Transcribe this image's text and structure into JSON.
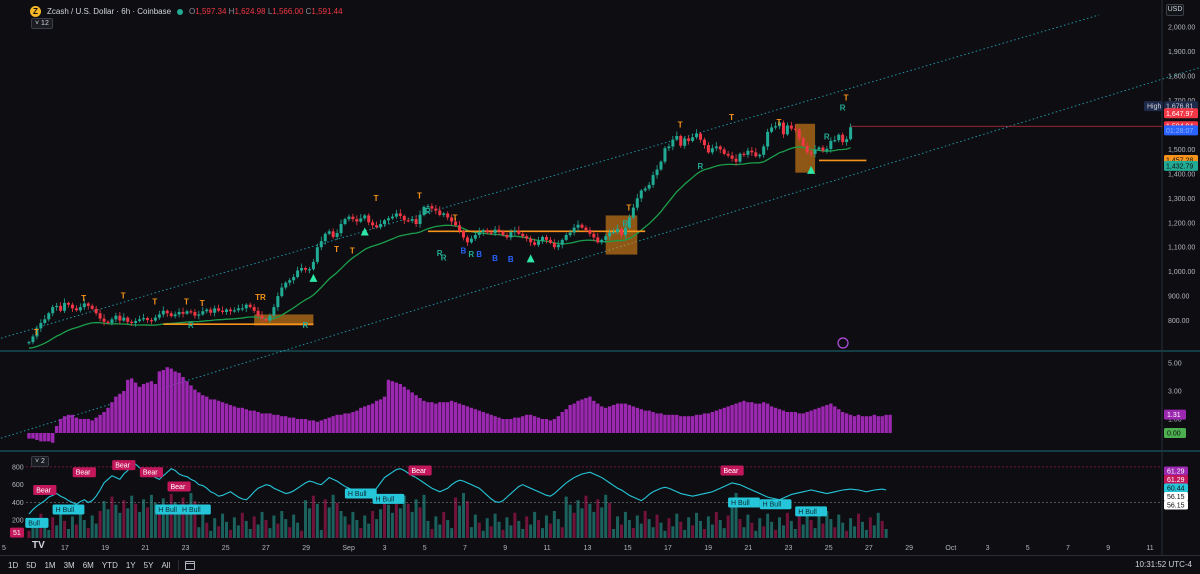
{
  "header": {
    "symbol_icon": "Z",
    "title": "Zcash / U.S. Dollar · 6h · Coinbase",
    "ohlc": [
      {
        "k": "O",
        "v": "1,597.34"
      },
      {
        "k": "H",
        "v": "1,624.98"
      },
      {
        "k": "L",
        "v": "1,566.00"
      },
      {
        "k": "C",
        "v": "1,591.44"
      }
    ],
    "indicator_badge": "12",
    "currency_button": "USD"
  },
  "osc_badge": "2",
  "rsi_badge": "51",
  "tradingview_logo": "TV",
  "bottom_toolbar": {
    "timeframes": [
      "1D",
      "5D",
      "1M",
      "3M",
      "6M",
      "YTD",
      "1Y",
      "5Y",
      "All"
    ],
    "clock": "10:31:52 UTC-4"
  },
  "colors": {
    "bull": "#22ab94",
    "bear": "#f23645",
    "volume": "#9c27b0",
    "channel": "#26c6da",
    "trend": "#1b9e4b",
    "box": "#f7931a",
    "price_line": "#f23645"
  },
  "chart_data": [
    {
      "type": "candlestick",
      "panel": "price",
      "ylim": [
        700,
        2050
      ],
      "y_ticks": [
        "800.00",
        "900.00",
        "1,000.00",
        "1,100.00",
        "1,200.00",
        "1,300.00",
        "1,400.00",
        "1,500.00",
        "1,600.00",
        "1,700.00",
        "1,800.00",
        "1,900.00",
        "2,000.00"
      ],
      "x_ticks": [
        "17",
        "19",
        "21",
        "23",
        "25",
        "27",
        "29",
        "Sep",
        "3",
        "5",
        "7",
        "9",
        "11",
        "13",
        "15",
        "17",
        "19",
        "21",
        "23",
        "25",
        "27",
        "29",
        "Oct",
        "3",
        "5",
        "7",
        "9",
        "11"
      ],
      "x_tick_pos": [
        16,
        18,
        20,
        22,
        24,
        26,
        28,
        30,
        32,
        34,
        36,
        38,
        40,
        42,
        44,
        46,
        48,
        50,
        52,
        54,
        56,
        58,
        60,
        62,
        64,
        66,
        68,
        70
      ],
      "x_start_label": "5",
      "closes": [
        712,
        735,
        768,
        790,
        805,
        830,
        855,
        860,
        840,
        872,
        865,
        850,
        842,
        855,
        870,
        860,
        848,
        830,
        808,
        795,
        790,
        805,
        820,
        800,
        812,
        795,
        790,
        798,
        805,
        810,
        802,
        800,
        812,
        825,
        840,
        830,
        818,
        825,
        835,
        828,
        838,
        835,
        820,
        825,
        838,
        845,
        832,
        850,
        840,
        835,
        845,
        838,
        842,
        850,
        850,
        865,
        855,
        840,
        820,
        808,
        800,
        820,
        855,
        900,
        935,
        955,
        965,
        978,
        1005,
        1015,
        1008,
        1010,
        1040,
        1100,
        1125,
        1155,
        1165,
        1142,
        1158,
        1195,
        1215,
        1225,
        1215,
        1205,
        1218,
        1230,
        1202,
        1190,
        1182,
        1195,
        1210,
        1218,
        1225,
        1238,
        1228,
        1210,
        1208,
        1215,
        1195,
        1232,
        1265,
        1268,
        1258,
        1250,
        1232,
        1238,
        1222,
        1205,
        1190,
        1166,
        1140,
        1120,
        1135,
        1150,
        1162,
        1170,
        1160,
        1158,
        1172,
        1165,
        1150,
        1140,
        1162,
        1168,
        1155,
        1145,
        1135,
        1120,
        1110,
        1125,
        1142,
        1130,
        1118,
        1100,
        1110,
        1130,
        1150,
        1160,
        1180,
        1192,
        1180,
        1170,
        1155,
        1140,
        1120,
        1130,
        1145,
        1160,
        1162,
        1175,
        1150,
        1180,
        1222,
        1262,
        1300,
        1332,
        1340,
        1355,
        1395,
        1418,
        1450,
        1505,
        1512,
        1540,
        1555,
        1515,
        1545,
        1535,
        1550,
        1565,
        1540,
        1518,
        1488,
        1505,
        1512,
        1500,
        1482,
        1475,
        1462,
        1450,
        1482,
        1478,
        1495,
        1488,
        1472,
        1478,
        1512,
        1572,
        1590,
        1595,
        1610,
        1562,
        1598,
        1585,
        1582,
        1545,
        1515,
        1488,
        1482,
        1500,
        1508,
        1495,
        1502,
        1535,
        1538,
        1560,
        1530,
        1542,
        1591
      ],
      "series": [
        {
          "name": "Zcash / U.S. Dollar",
          "values_key": "closes"
        }
      ],
      "price_labels": [
        {
          "label": "High",
          "value": "1,676.81"
        },
        {
          "value": "1,647.97"
        },
        {
          "value": "1,594.94"
        },
        {
          "value": "01:28:07"
        },
        {
          "value": "1,457.28"
        },
        {
          "value": "1,432.79"
        }
      ],
      "channel": {
        "upper": [
          [
            -3,
            700
          ],
          [
            63,
            2050
          ]
        ],
        "lower": [
          [
            -3,
            290
          ],
          [
            78,
            2030
          ]
        ]
      },
      "signals": [
        {
          "text": "T",
          "i": 14,
          "v": 880
        },
        {
          "text": "T",
          "i": 24,
          "v": 890
        },
        {
          "text": "T",
          "i": 32,
          "v": 865
        },
        {
          "text": "T",
          "i": 40,
          "v": 865
        },
        {
          "text": "T",
          "i": 44,
          "v": 860
        },
        {
          "text": "T",
          "i": 2,
          "v": 740
        },
        {
          "text": "TR",
          "i": 58,
          "v": 885
        },
        {
          "text": "R",
          "i": 41,
          "v": 770
        },
        {
          "text": "R",
          "i": 70,
          "v": 770
        },
        {
          "text": "R",
          "i": 105,
          "v": 1045
        },
        {
          "text": "R",
          "i": 112,
          "v": 1060
        },
        {
          "text": "T",
          "i": 78,
          "v": 1080
        },
        {
          "text": "T",
          "i": 82,
          "v": 1075
        },
        {
          "text": "T",
          "i": 88,
          "v": 1290
        },
        {
          "text": "T",
          "i": 99,
          "v": 1300
        },
        {
          "text": "R",
          "i": 101,
          "v": 1235
        },
        {
          "text": "R",
          "i": 104,
          "v": 1065
        },
        {
          "text": "T",
          "i": 108,
          "v": 1210
        },
        {
          "text": "B",
          "i": 110,
          "v": 1075
        },
        {
          "text": "B",
          "i": 114,
          "v": 1060
        },
        {
          "text": "B",
          "i": 118,
          "v": 1043
        },
        {
          "text": "B",
          "i": 122,
          "v": 1040
        },
        {
          "text": "T",
          "i": 152,
          "v": 1250
        },
        {
          "text": "R",
          "i": 151,
          "v": 1185
        },
        {
          "text": "T",
          "i": 165,
          "v": 1590
        },
        {
          "text": "T",
          "i": 178,
          "v": 1620
        },
        {
          "text": "R",
          "i": 170,
          "v": 1420
        },
        {
          "text": "T",
          "i": 190,
          "v": 1600
        },
        {
          "text": "T",
          "i": 207,
          "v": 1700
        },
        {
          "text": "R",
          "i": 206,
          "v": 1660
        },
        {
          "text": "R",
          "i": 202,
          "v": 1540
        }
      ],
      "triangles": [
        72,
        85,
        127,
        198
      ],
      "boxes": [
        {
          "from": 57,
          "to": 72,
          "low": 780,
          "high": 825
        },
        {
          "from": 146,
          "to": 154,
          "low": 1070,
          "high": 1230
        },
        {
          "from": 194,
          "to": 199,
          "low": 1405,
          "high": 1605
        }
      ],
      "support_lines": [
        {
          "from": 34,
          "to": 72,
          "v": 785
        },
        {
          "from": 101,
          "to": 156,
          "v": 1165
        },
        {
          "from": 200,
          "to": 212,
          "v": 1455
        }
      ],
      "last_price": "1,594.94"
    },
    {
      "type": "bar",
      "panel": "volume",
      "ylim": [
        -1,
        5.5
      ],
      "y_ticks": [
        "1.00",
        "3.00",
        "5.00"
      ],
      "value_labels": [
        "1.31",
        "0.00"
      ],
      "values": [
        -0.4,
        -0.4,
        -0.5,
        -0.6,
        -0.6,
        -0.6,
        -0.7,
        0.5,
        1.0,
        1.2,
        1.3,
        1.3,
        1.1,
        1.0,
        1.0,
        1.0,
        0.9,
        1.1,
        1.3,
        1.5,
        1.8,
        2.2,
        2.6,
        2.8,
        3.0,
        3.8,
        3.9,
        3.6,
        3.3,
        3.5,
        3.6,
        3.7,
        3.5,
        4.4,
        4.5,
        4.7,
        4.6,
        4.4,
        4.3,
        4.0,
        3.7,
        3.4,
        3.1,
        2.9,
        2.7,
        2.6,
        2.4,
        2.4,
        2.3,
        2.2,
        2.1,
        2.0,
        1.9,
        1.8,
        1.8,
        1.7,
        1.6,
        1.6,
        1.5,
        1.4,
        1.4,
        1.4,
        1.3,
        1.3,
        1.2,
        1.2,
        1.1,
        1.1,
        1.0,
        1.0,
        1.0,
        0.9,
        0.9,
        0.8,
        0.9,
        1.0,
        1.1,
        1.2,
        1.3,
        1.3,
        1.4,
        1.4,
        1.5,
        1.6,
        1.8,
        1.9,
        2.0,
        2.1,
        2.3,
        2.4,
        2.6,
        3.8,
        3.7,
        3.6,
        3.5,
        3.3,
        3.1,
        2.9,
        2.7,
        2.5,
        2.3,
        2.2,
        2.2,
        2.1,
        2.2,
        2.2,
        2.2,
        2.3,
        2.2,
        2.1,
        2.0,
        1.9,
        1.8,
        1.7,
        1.6,
        1.5,
        1.4,
        1.3,
        1.2,
        1.1,
        1.0,
        1.0,
        1.0,
        1.1,
        1.1,
        1.2,
        1.3,
        1.3,
        1.2,
        1.1,
        1.0,
        1.0,
        0.9,
        1.0,
        1.2,
        1.5,
        1.7,
        2.0,
        2.1,
        2.3,
        2.4,
        2.5,
        2.6,
        2.3,
        2.1,
        1.9,
        1.8,
        1.9,
        2.0,
        2.1,
        2.1,
        2.1,
        2.0,
        1.9,
        1.8,
        1.7,
        1.6,
        1.6,
        1.5,
        1.4,
        1.4,
        1.3,
        1.3,
        1.3,
        1.3,
        1.2,
        1.2,
        1.2,
        1.2,
        1.3,
        1.3,
        1.4,
        1.4,
        1.5,
        1.6,
        1.7,
        1.8,
        1.9,
        2.0,
        2.1,
        2.2,
        2.3,
        2.2,
        2.2,
        2.1,
        2.1,
        2.2,
        2.1,
        1.9,
        1.8,
        1.7,
        1.6,
        1.5,
        1.5,
        1.5,
        1.4,
        1.4,
        1.5,
        1.6,
        1.7,
        1.8,
        1.9,
        2.0,
        2.1,
        1.9,
        1.7,
        1.5,
        1.4,
        1.3,
        1.2,
        1.3,
        1.2,
        1.2,
        1.2,
        1.3,
        1.2,
        1.2,
        1.3,
        1.3
      ]
    },
    {
      "type": "line",
      "panel": "oscillator",
      "ylim": [
        0,
        900
      ],
      "y_ticks": [
        "800",
        "600",
        "400",
        "200"
      ],
      "value_labels": [
        "61.29",
        "61.29",
        "60.44",
        "56.15",
        "56.15"
      ],
      "values": [
        270,
        320,
        360,
        390,
        420,
        460,
        480,
        500,
        470,
        450,
        420,
        400,
        380,
        410,
        430,
        400,
        420,
        470,
        540,
        620,
        660,
        700,
        680,
        660,
        720,
        760,
        800,
        830,
        790,
        770,
        740,
        710,
        680,
        660,
        700,
        740,
        780,
        760,
        720,
        700,
        690,
        660,
        640,
        600,
        590,
        560,
        520,
        500,
        470,
        480,
        500,
        520,
        490,
        460,
        440,
        430,
        470,
        520,
        560,
        580,
        600,
        590,
        560,
        540,
        520,
        500,
        510,
        530,
        560,
        590,
        620,
        640,
        630,
        610,
        600,
        640,
        680,
        660,
        640,
        610,
        580,
        560,
        540,
        520,
        500,
        480,
        460,
        500,
        560,
        620,
        680,
        710,
        740,
        770,
        780,
        760,
        730,
        700,
        680,
        650,
        620,
        590,
        560,
        540,
        520,
        540,
        560,
        600,
        630,
        650,
        640,
        620,
        600,
        580,
        560,
        520,
        480,
        440,
        410,
        400,
        420,
        460,
        500,
        540,
        580,
        600,
        580,
        560,
        540,
        520,
        500,
        480,
        470,
        500,
        540,
        580,
        620,
        650,
        680,
        700,
        720,
        730,
        740,
        720,
        700,
        680,
        650,
        620,
        590,
        560,
        540,
        510,
        480,
        460,
        440,
        420,
        450,
        490,
        520,
        540,
        560,
        570,
        560,
        540,
        520,
        500,
        490,
        480,
        470,
        480,
        490,
        500,
        510,
        520,
        540,
        560,
        580,
        600,
        620,
        610,
        600,
        580,
        560,
        540,
        520,
        500,
        480,
        460,
        450,
        440,
        430,
        450,
        470,
        490,
        500,
        510,
        520,
        530,
        540,
        530,
        520,
        510,
        500,
        510,
        520,
        530,
        540,
        545,
        550,
        545,
        540,
        530,
        520,
        530,
        540,
        545,
        550,
        540
      ],
      "series": [
        {
          "name": "",
          "values_key": "values"
        }
      ],
      "labels": [
        {
          "text": "Bull",
          "type": "bull",
          "i": 2,
          "v": 170
        },
        {
          "text": "Bear",
          "type": "bear",
          "i": 4,
          "v": 540
        },
        {
          "text": "H Bull",
          "type": "bull",
          "i": 10,
          "v": 320
        },
        {
          "text": "Bear",
          "type": "bear",
          "i": 14,
          "v": 740
        },
        {
          "text": "Bear",
          "type": "bear",
          "i": 24,
          "v": 820
        },
        {
          "text": "Bear",
          "type": "bear",
          "i": 31,
          "v": 740
        },
        {
          "text": "Bear",
          "type": "bear",
          "i": 38,
          "v": 580
        },
        {
          "text": "H Bull",
          "type": "bull",
          "i": 36,
          "v": 320
        },
        {
          "text": "H Bull",
          "type": "bull",
          "i": 42,
          "v": 320
        },
        {
          "text": "H Bull",
          "type": "bull",
          "i": 84,
          "v": 500
        },
        {
          "text": "H Bull",
          "type": "bull",
          "i": 91,
          "v": 440
        },
        {
          "text": "Bear",
          "type": "bear",
          "i": 99,
          "v": 760
        },
        {
          "text": "Bear",
          "type": "bear",
          "i": 178,
          "v": 760
        },
        {
          "text": "H Bull",
          "type": "bull",
          "i": 181,
          "v": 400
        },
        {
          "text": "H Bull",
          "type": "bull",
          "i": 189,
          "v": 380
        },
        {
          "text": "H Bull",
          "type": "bull",
          "i": 198,
          "v": 300
        }
      ]
    }
  ]
}
